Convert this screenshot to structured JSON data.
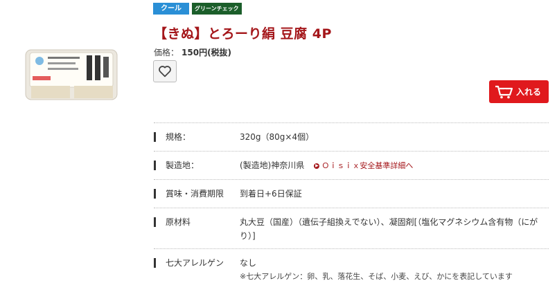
{
  "badges": {
    "cool": "クール",
    "green": "グリーンチェック"
  },
  "product": {
    "title": "【きぬ】とろーり絹 豆腐 4P",
    "price_label": "価格：",
    "price_value": "150円(税抜)",
    "image_label": "とろーり絹豆腐"
  },
  "actions": {
    "cart_label": "入れる"
  },
  "specs": [
    {
      "key": "規格：",
      "value": "320g（80g×4個）"
    },
    {
      "key": "製造地：",
      "value": "(製造地)神奈川県",
      "link": "Ｏｉｓｉｘ安全基準詳細へ"
    },
    {
      "key": "賞味・消費期限",
      "value": "到着日+6日保証"
    },
    {
      "key": "原材料",
      "value": "丸大豆（国産）（遺伝子組換えでない）、凝固剤[（塩化マグネシウム含有物（にがり）]"
    },
    {
      "key": "七大アレルゲン",
      "value": "なし",
      "note": "※七大アレルゲン：卵、乳、落花生、そば、小麦、えび、かにを表記しています"
    }
  ],
  "colors": {
    "accent": "#a4161a",
    "cart": "#e0191d",
    "cool_badge": "#2a8fd6",
    "green_badge": "#1b5e2a"
  }
}
